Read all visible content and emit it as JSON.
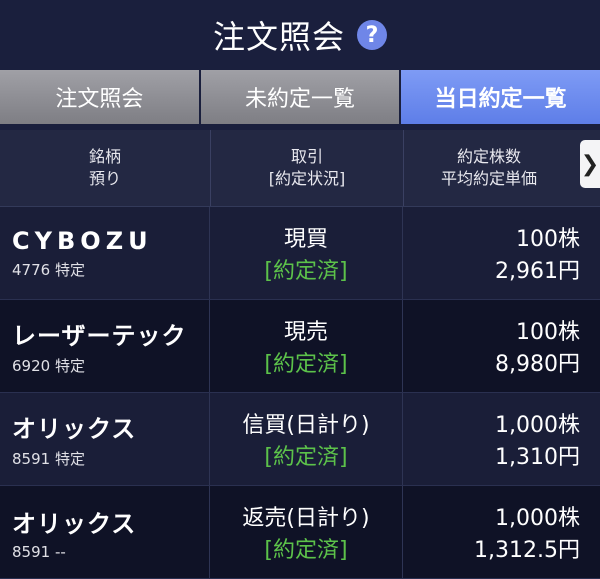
{
  "header": {
    "title": "注文照会",
    "help_icon": "?"
  },
  "tabs": [
    {
      "label": "注文照会",
      "active": false
    },
    {
      "label": "未約定一覧",
      "active": false
    },
    {
      "label": "当日約定一覧",
      "active": true
    }
  ],
  "columns": {
    "col1_line1": "銘柄",
    "col1_line2": "預り",
    "col2_line1": "取引",
    "col2_line2": "[約定状況]",
    "col3_line1": "約定株数",
    "col3_line2": "平均約定単価",
    "more_icon": "❯"
  },
  "rows": [
    {
      "name": "CYBOZU",
      "code": "4776 特定",
      "trade": "現買",
      "status": "[約定済]",
      "shares": "100株",
      "price": "2,961円"
    },
    {
      "name": "レーザーテック",
      "code": "6920 特定",
      "trade": "現売",
      "status": "[約定済]",
      "shares": "100株",
      "price": "8,980円"
    },
    {
      "name": "オリックス",
      "code": "8591 特定",
      "trade": "信買(日計り)",
      "status": "[約定済]",
      "shares": "1,000株",
      "price": "1,310円"
    },
    {
      "name": "オリックス",
      "code": "8591 --",
      "trade": "返売(日計り)",
      "status": "[約定済]",
      "shares": "1,000株",
      "price": "1,312.5円"
    }
  ],
  "colors": {
    "accent": "#6f86e8",
    "status_green": "#5cc24a",
    "tab_active": "#6a88ee"
  }
}
